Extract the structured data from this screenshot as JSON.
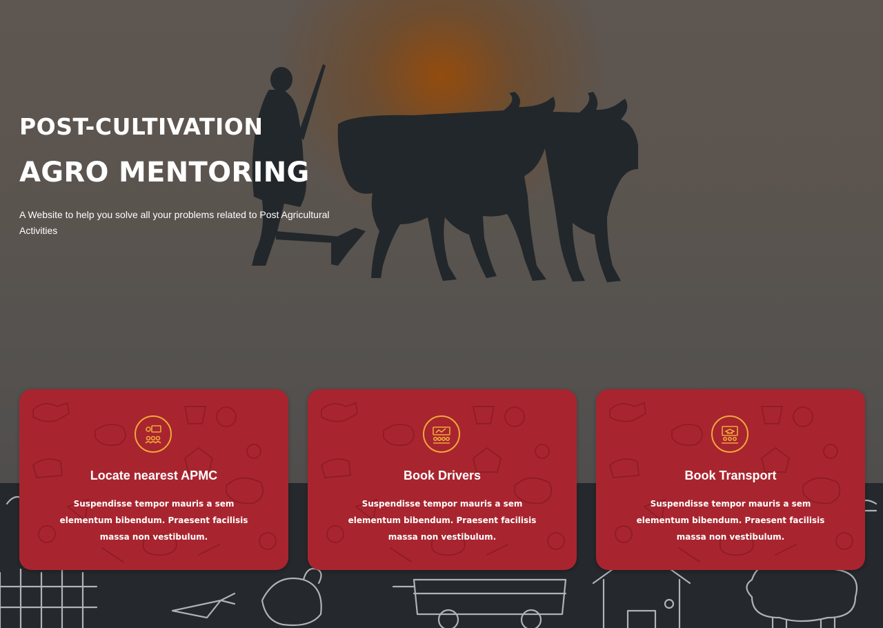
{
  "hero": {
    "kicker": "POST-CULTIVATION",
    "headline": "AGRO MENTORING",
    "description": "A Website to help you solve all your problems related to Post Agricultural Activities"
  },
  "cards": [
    {
      "icon": "apmc-market-icon",
      "title": "Locate nearest APMC",
      "text": "Suspendisse tempor mauris a sem elementum bibendum. Praesent facilisis massa non vestibulum."
    },
    {
      "icon": "drivers-icon",
      "title": "Book Drivers",
      "text": "Suspendisse tempor mauris a sem elementum bibendum. Praesent facilisis massa non vestibulum."
    },
    {
      "icon": "transport-icon",
      "title": "Book Transport",
      "text": "Suspendisse tempor mauris a sem elementum bibendum. Praesent facilisis massa non vestibulum."
    }
  ],
  "colors": {
    "card_red": "#a8252f",
    "icon_orange": "#f0a93a",
    "footer_dark": "#25282c",
    "sun_orange": "#964b0a"
  }
}
